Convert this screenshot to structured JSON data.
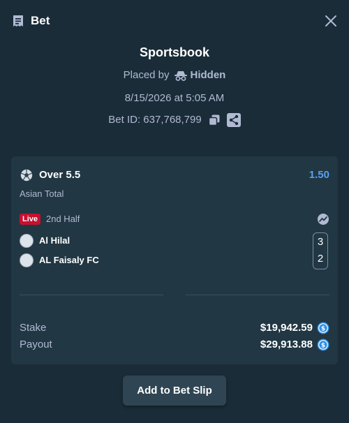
{
  "header": {
    "title": "Bet",
    "icon": "receipt-icon",
    "close_icon": "close-icon"
  },
  "info": {
    "title": "Sportsbook",
    "placed_by_label": "Placed by",
    "placed_by_user": "Hidden",
    "datetime": "8/15/2026 at 5:05 AM",
    "bet_id": "Bet ID: 637,768,799"
  },
  "bet": {
    "market": "Over 5.5",
    "odds": "1.50",
    "market_type": "Asian Total",
    "live_label": "Live",
    "period": "2nd Half",
    "teams": [
      {
        "name": "Al Hilal",
        "score": "3"
      },
      {
        "name": "AL Faisaly FC",
        "score": "2"
      }
    ],
    "stake_label": "Stake",
    "stake_value": "$19,942.59",
    "payout_label": "Payout",
    "payout_value": "$29,913.88"
  },
  "actions": {
    "add_to_slip": "Add to Bet Slip"
  },
  "colors": {
    "background": "#1a2c38",
    "card": "#213743",
    "accent_odds": "#5aa0f0",
    "live_badge": "#c8102e",
    "coin": "#2d8fe6"
  }
}
